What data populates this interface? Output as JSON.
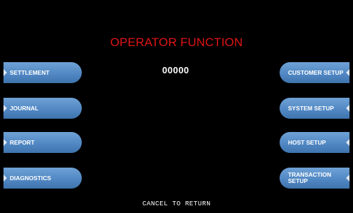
{
  "screen": {
    "title": "OPERATOR FUNCTION",
    "code": "00000",
    "footer": "CANCEL TO RETURN"
  },
  "left_buttons": [
    {
      "label": "SETTLEMENT"
    },
    {
      "label": "JOURNAL"
    },
    {
      "label": "REPORT"
    },
    {
      "label": "DIAGNOSTICS"
    }
  ],
  "right_buttons": [
    {
      "label": "CUSTOMER SETUP"
    },
    {
      "label": "SYSTEM SETUP"
    },
    {
      "label": "HOST SETUP"
    },
    {
      "label": "TRANSACTION SETUP"
    }
  ],
  "colors": {
    "background": "#000000",
    "title": "#e01515",
    "button": "#4f86c2",
    "text": "#ffffff"
  }
}
